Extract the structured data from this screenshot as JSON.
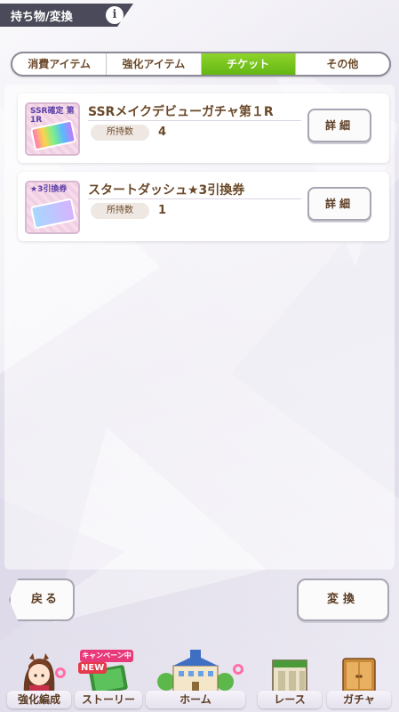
{
  "header": {
    "title": "持ち物/変換",
    "info_glyph": "i"
  },
  "tabs": [
    {
      "label": "消費アイテム",
      "active": false
    },
    {
      "label": "強化アイテム",
      "active": false
    },
    {
      "label": "チケット",
      "active": true
    },
    {
      "label": "その他",
      "active": false
    }
  ],
  "items": [
    {
      "name": "SSRメイクデビューガチャ第１R",
      "thumb_label": "SSR確定 第1R",
      "qty_label": "所持数",
      "qty": "4",
      "detail_label": "詳細"
    },
    {
      "name": "スタートダッシュ★3引換券",
      "thumb_label": "★3引換券",
      "qty_label": "所持数",
      "qty": "1",
      "detail_label": "詳細"
    }
  ],
  "buttons": {
    "back": "戻る",
    "convert": "変換"
  },
  "nav": [
    {
      "label": "強化編成",
      "icon": "horse-girl-icon"
    },
    {
      "label": "ストーリー",
      "icon": "story-book-icon",
      "badge": "NEW",
      "campaign": "キャンペーン中"
    },
    {
      "label": "ホーム",
      "icon": "school-building-icon"
    },
    {
      "label": "レース",
      "icon": "race-gate-icon"
    },
    {
      "label": "ガチャ",
      "icon": "gacha-door-icon"
    }
  ],
  "colors": {
    "active_tab": "#7cc61e",
    "text_brown": "#6b4a2a",
    "header_bg": "#4a4a5a"
  }
}
